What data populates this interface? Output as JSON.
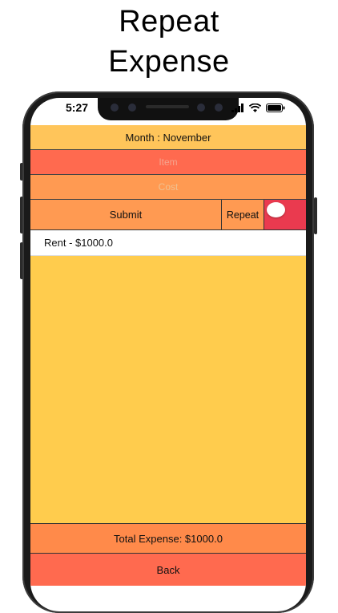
{
  "headline": {
    "line1": "Repeat",
    "line2": "Expense"
  },
  "status_bar": {
    "time": "5:27",
    "icons": [
      "signal-icon",
      "wifi-icon",
      "battery-icon"
    ]
  },
  "form": {
    "month_label": "Month : November",
    "item_placeholder": "Item",
    "cost_placeholder": "Cost",
    "submit_label": "Submit",
    "repeat_label": "Repeat",
    "repeat_toggle_on": false
  },
  "expenses": [
    {
      "text": "Rent - $1000.0"
    }
  ],
  "footer": {
    "total_label": "Total Expense: $1000.0",
    "back_label": "Back"
  },
  "colors": {
    "month_bg": "#ffc55a",
    "item_bg": "#ff6a4f",
    "cost_bg": "#ff9a52",
    "toggle_bg": "#ea3a4f",
    "list_bg": "#ffcc4d",
    "total_bg": "#ff8a4a",
    "back_bg": "#ff6a4f"
  }
}
